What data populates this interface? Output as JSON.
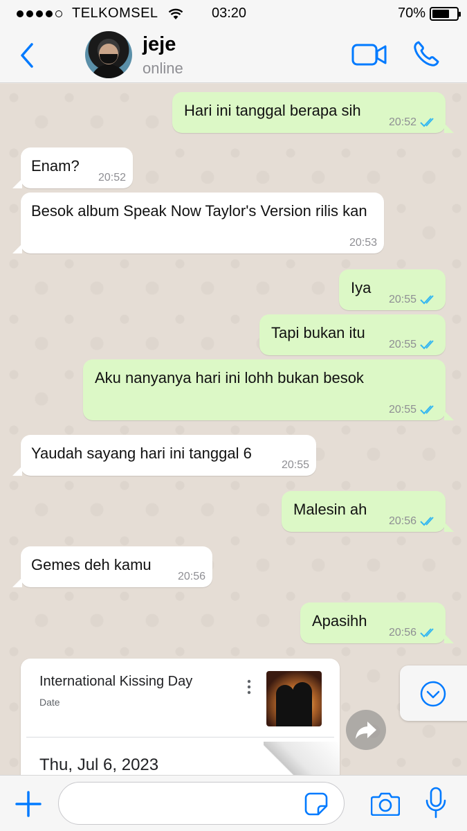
{
  "status_bar": {
    "carrier": "TELKOMSEL",
    "time": "03:20",
    "battery_percent": "70%",
    "battery_level": 0.7,
    "signal_bars": 4,
    "signal_max": 5
  },
  "header": {
    "contact_name": "jeje",
    "contact_status": "online",
    "icons": [
      "chevron-left-icon",
      "avatar",
      "video-call-icon",
      "phone-icon"
    ]
  },
  "messages": [
    {
      "direction": "out",
      "text": "Hari ini tanggal berapa sih",
      "time": "20:52",
      "read": true
    },
    {
      "direction": "in",
      "text": "Enam?",
      "time": "20:52"
    },
    {
      "direction": "in",
      "text": "Besok album Speak Now Taylor's Version rilis kan",
      "time": "20:53"
    },
    {
      "direction": "out",
      "text": "Iya",
      "time": "20:55",
      "read": true
    },
    {
      "direction": "out",
      "text": "Tapi bukan itu",
      "time": "20:55",
      "read": true
    },
    {
      "direction": "out",
      "text": "Aku nanyanya hari ini lohh bukan besok",
      "time": "20:55",
      "read": true
    },
    {
      "direction": "in",
      "text": "Yaudah sayang hari ini tanggal 6",
      "time": "20:55"
    },
    {
      "direction": "out",
      "text": "Malesin ah",
      "time": "20:56",
      "read": true
    },
    {
      "direction": "in",
      "text": "Gemes deh kamu",
      "time": "20:56"
    },
    {
      "direction": "out",
      "text": "Apasihh",
      "time": "20:56",
      "read": true
    }
  ],
  "card": {
    "title": "International Kissing Day",
    "subtitle": "Date",
    "date": "Thu, Jul 6, 2023"
  },
  "input": {
    "value": "",
    "placeholder": ""
  },
  "colors": {
    "accent": "#007aff",
    "outgoing_bubble": "#dcf8c6",
    "incoming_bubble": "#ffffff",
    "read_ticks": "#34b7f1",
    "chat_background": "#e5ddd5"
  }
}
